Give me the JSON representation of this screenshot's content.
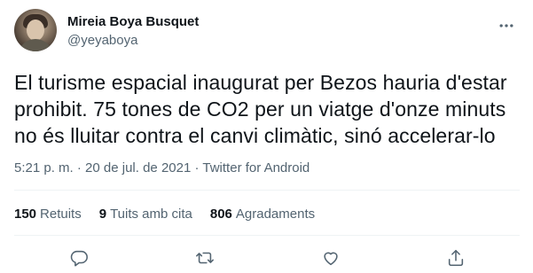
{
  "author": {
    "display_name": "Mireia Boya Busquet",
    "handle": "@yeyaboya"
  },
  "tweet": {
    "lines": [
      "El turisme espacial inaugurat per Bezos hauria d'estar",
      "prohibit. 75 tones de CO2 per un viatge d'onze minuts",
      "no és lluitar contra el canvi climàtic, sinó accelerar-lo"
    ],
    "time": "5:21 p. m.",
    "separator": " · ",
    "date": "20 de jul. de 2021",
    "source": "Twitter for Android"
  },
  "stats": {
    "retweets": {
      "count": "150",
      "label": "Retuits"
    },
    "quotes": {
      "count": "9",
      "label": "Tuits amb cita"
    },
    "likes": {
      "count": "806",
      "label": "Agradaments"
    }
  },
  "icons": {
    "more": "more-options-icon",
    "reply": "reply-icon",
    "retweet": "retweet-icon",
    "like": "heart-icon",
    "share": "share-icon"
  },
  "colors": {
    "text": "#0f1419",
    "secondary": "#536471",
    "divider": "#eff3f4"
  }
}
